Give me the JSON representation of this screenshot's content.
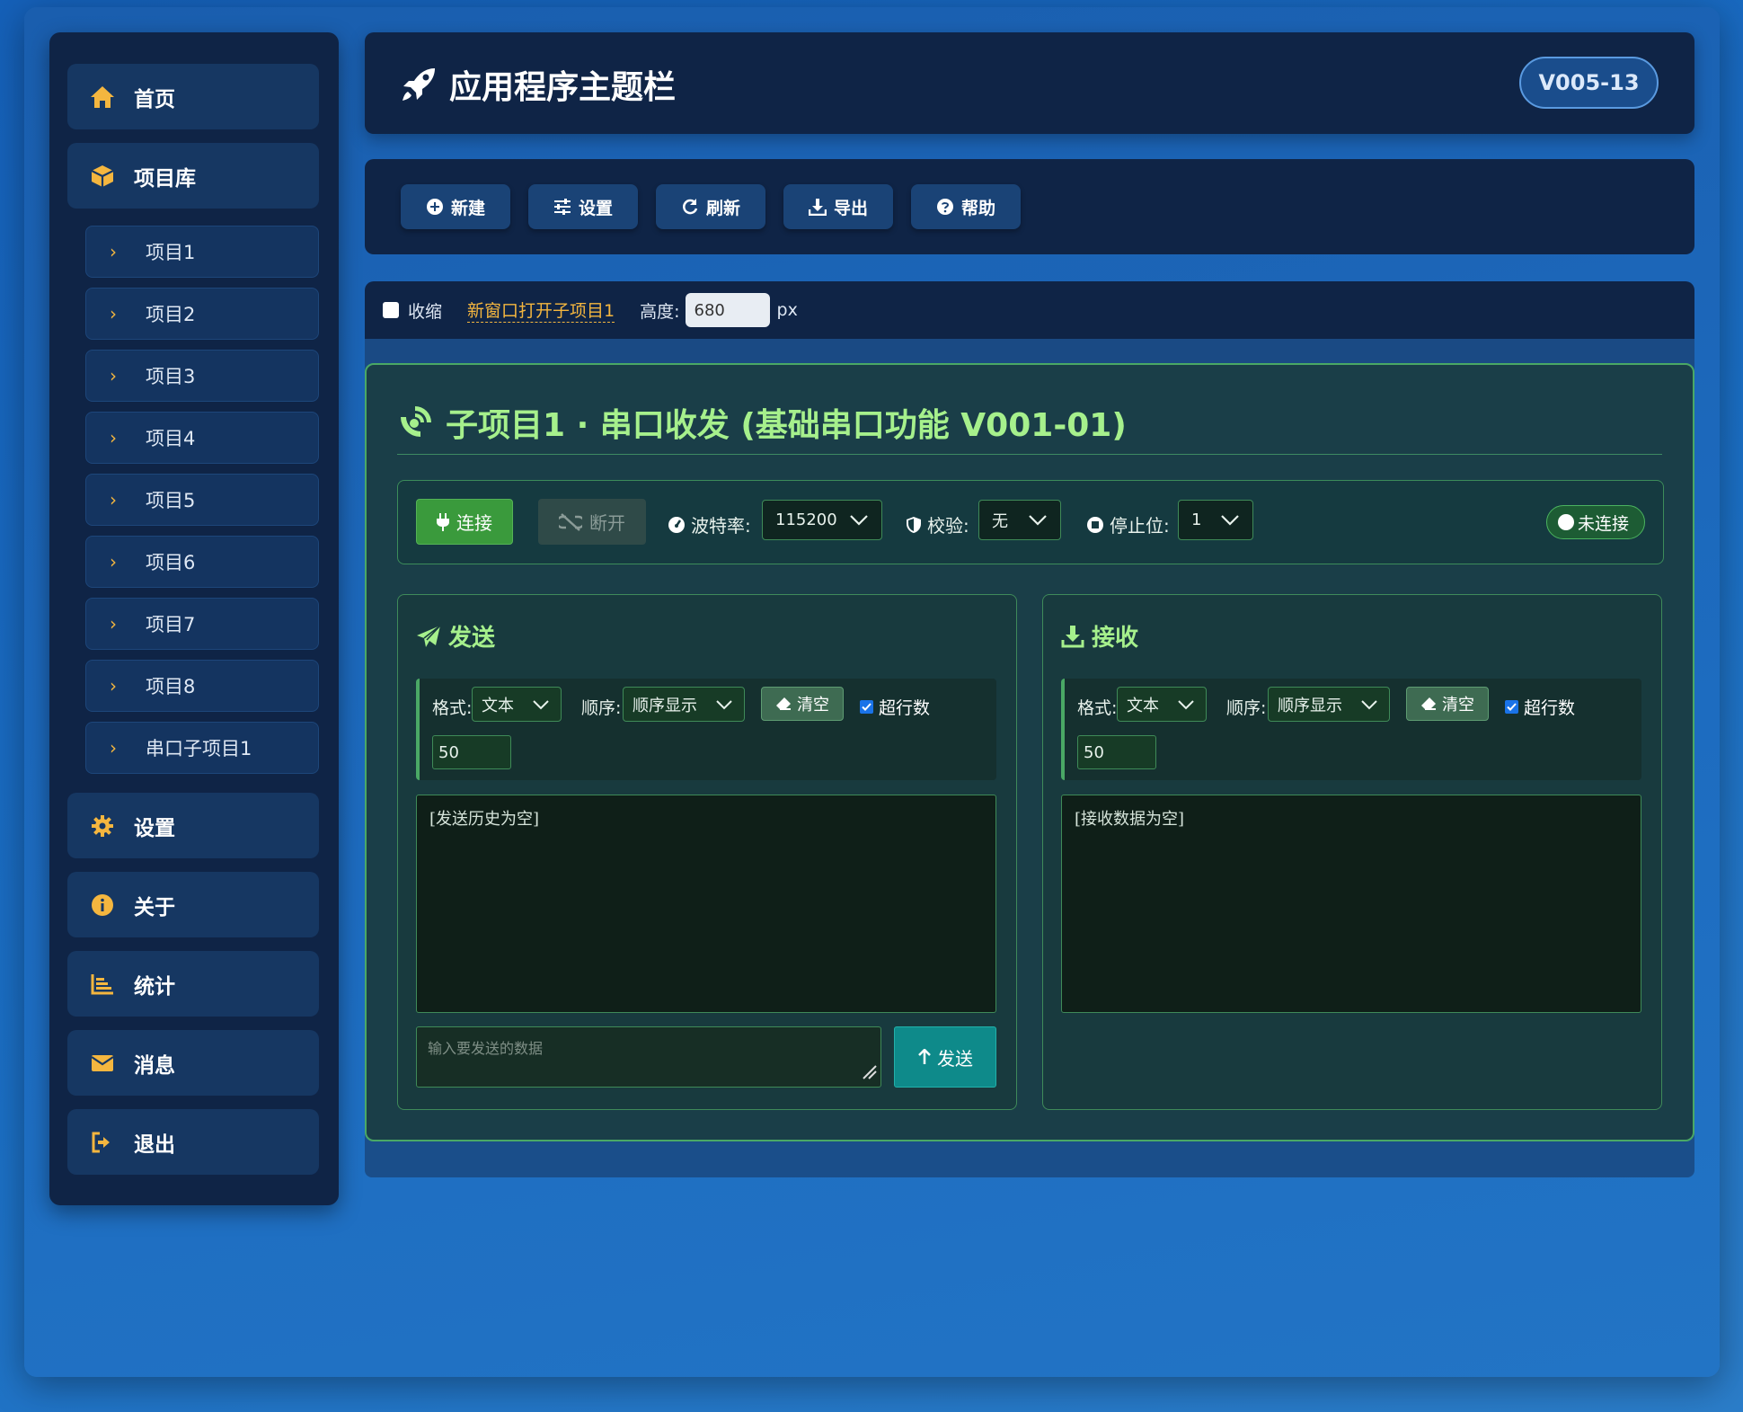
{
  "sidebar": {
    "items": [
      {
        "label": "首页",
        "icon": "home-icon"
      },
      {
        "label": "项目库",
        "icon": "cube-icon"
      },
      {
        "label": "设置",
        "icon": "gear-icon"
      },
      {
        "label": "关于",
        "icon": "info-icon"
      },
      {
        "label": "统计",
        "icon": "chart-icon"
      },
      {
        "label": "消息",
        "icon": "envelope-icon"
      },
      {
        "label": "退出",
        "icon": "logout-icon"
      }
    ],
    "sub_items": [
      "项目1",
      "项目2",
      "项目3",
      "项目4",
      "项目5",
      "项目6",
      "项目7",
      "项目8",
      "串口子项目1"
    ]
  },
  "header": {
    "title": "应用程序主题栏",
    "version": "V005-13"
  },
  "toolbar": {
    "new_label": "新建",
    "settings_label": "设置",
    "refresh_label": "刷新",
    "export_label": "导出",
    "help_label": "帮助"
  },
  "options": {
    "collapse_label": "收缩",
    "open_link": "新窗口打开子项目1",
    "height_label": "高度:",
    "height_value": "680",
    "height_unit": "px"
  },
  "panel": {
    "title": "子项目1 · 串口收发 (基础串口功能 V001-01)",
    "connect_label": "连接",
    "disconnect_label": "断开",
    "baud_label": "波特率:",
    "baud_value": "115200",
    "parity_label": "校验:",
    "parity_value": "无",
    "stopbit_label": "停止位:",
    "stopbit_value": "1",
    "status": "未连接"
  },
  "send": {
    "title": "发送",
    "format_label": "格式:",
    "format_value": "文本",
    "order_label": "顺序:",
    "order_value": "顺序显示",
    "clear_label": "清空",
    "overflow_label": "超行数",
    "overflow_value": "50",
    "history": "[发送历史为空]",
    "input_placeholder": "输入要发送的数据",
    "send_label": "发送"
  },
  "receive": {
    "title": "接收",
    "format_label": "格式:",
    "format_value": "文本",
    "order_label": "顺序:",
    "order_value": "顺序显示",
    "clear_label": "清空",
    "overflow_label": "超行数",
    "overflow_value": "50",
    "history": "[接收数据为空]"
  },
  "colors": {
    "accent_yellow": "#f4b63f",
    "accent_green": "#a6f08c",
    "panel_border": "#4aa865",
    "connect_green": "#3a9a3c",
    "send_teal": "#0e8a8a"
  }
}
